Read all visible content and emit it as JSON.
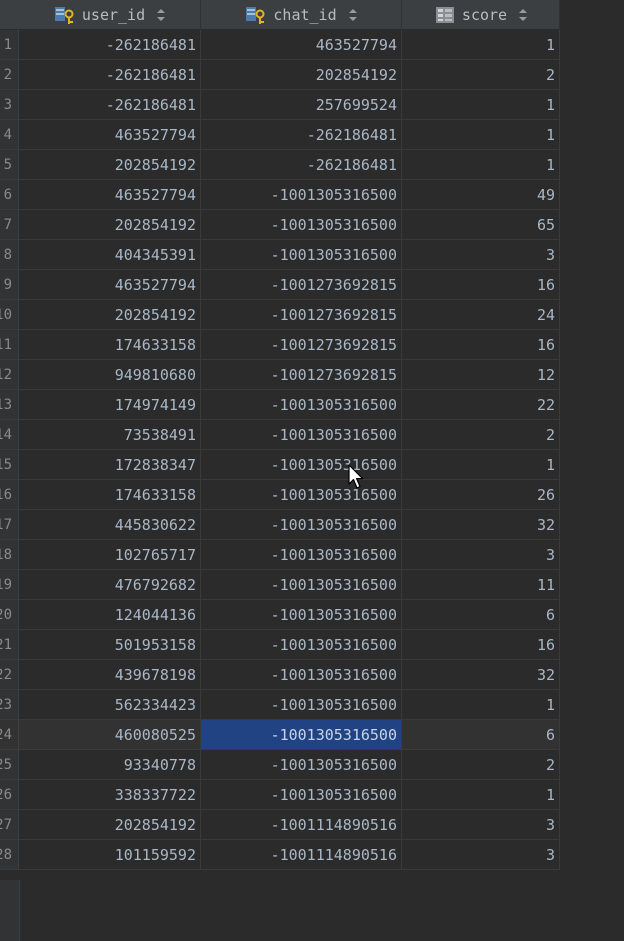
{
  "columns": [
    {
      "name": "user_id",
      "icon": "key-column-icon"
    },
    {
      "name": "chat_id",
      "icon": "key-column-icon"
    },
    {
      "name": "score",
      "icon": "column-icon"
    }
  ],
  "rows": [
    {
      "num": "1",
      "user_id": "-262186481",
      "chat_id": "463527794",
      "score": "1"
    },
    {
      "num": "2",
      "user_id": "-262186481",
      "chat_id": "202854192",
      "score": "2"
    },
    {
      "num": "3",
      "user_id": "-262186481",
      "chat_id": "257699524",
      "score": "1"
    },
    {
      "num": "4",
      "user_id": "463527794",
      "chat_id": "-262186481",
      "score": "1"
    },
    {
      "num": "5",
      "user_id": "202854192",
      "chat_id": "-262186481",
      "score": "1"
    },
    {
      "num": "6",
      "user_id": "463527794",
      "chat_id": "-1001305316500",
      "score": "49"
    },
    {
      "num": "7",
      "user_id": "202854192",
      "chat_id": "-1001305316500",
      "score": "65"
    },
    {
      "num": "8",
      "user_id": "404345391",
      "chat_id": "-1001305316500",
      "score": "3"
    },
    {
      "num": "9",
      "user_id": "463527794",
      "chat_id": "-1001273692815",
      "score": "16"
    },
    {
      "num": "10",
      "user_id": "202854192",
      "chat_id": "-1001273692815",
      "score": "24"
    },
    {
      "num": "11",
      "user_id": "174633158",
      "chat_id": "-1001273692815",
      "score": "16"
    },
    {
      "num": "12",
      "user_id": "949810680",
      "chat_id": "-1001273692815",
      "score": "12"
    },
    {
      "num": "13",
      "user_id": "174974149",
      "chat_id": "-1001305316500",
      "score": "22"
    },
    {
      "num": "14",
      "user_id": "73538491",
      "chat_id": "-1001305316500",
      "score": "2"
    },
    {
      "num": "15",
      "user_id": "172838347",
      "chat_id": "-1001305316500",
      "score": "1"
    },
    {
      "num": "16",
      "user_id": "174633158",
      "chat_id": "-1001305316500",
      "score": "26"
    },
    {
      "num": "17",
      "user_id": "445830622",
      "chat_id": "-1001305316500",
      "score": "32"
    },
    {
      "num": "18",
      "user_id": "102765717",
      "chat_id": "-1001305316500",
      "score": "3"
    },
    {
      "num": "19",
      "user_id": "476792682",
      "chat_id": "-1001305316500",
      "score": "11"
    },
    {
      "num": "20",
      "user_id": "124044136",
      "chat_id": "-1001305316500",
      "score": "6"
    },
    {
      "num": "21",
      "user_id": "501953158",
      "chat_id": "-1001305316500",
      "score": "16"
    },
    {
      "num": "22",
      "user_id": "439678198",
      "chat_id": "-1001305316500",
      "score": "32"
    },
    {
      "num": "23",
      "user_id": "562334423",
      "chat_id": "-1001305316500",
      "score": "1"
    },
    {
      "num": "24",
      "user_id": "460080525",
      "chat_id": "-1001305316500",
      "score": "6"
    },
    {
      "num": "25",
      "user_id": "93340778",
      "chat_id": "-1001305316500",
      "score": "2"
    },
    {
      "num": "26",
      "user_id": "338337722",
      "chat_id": "-1001305316500",
      "score": "1"
    },
    {
      "num": "27",
      "user_id": "202854192",
      "chat_id": "-1001114890516",
      "score": "3"
    },
    {
      "num": "28",
      "user_id": "101159592",
      "chat_id": "-1001114890516",
      "score": "3"
    }
  ],
  "selection": {
    "row_index": 23,
    "column": "chat_id"
  },
  "colors": {
    "background": "#2b2b2b",
    "header": "#3c3f41",
    "selection": "#214283",
    "text": "#a9b7c6"
  }
}
